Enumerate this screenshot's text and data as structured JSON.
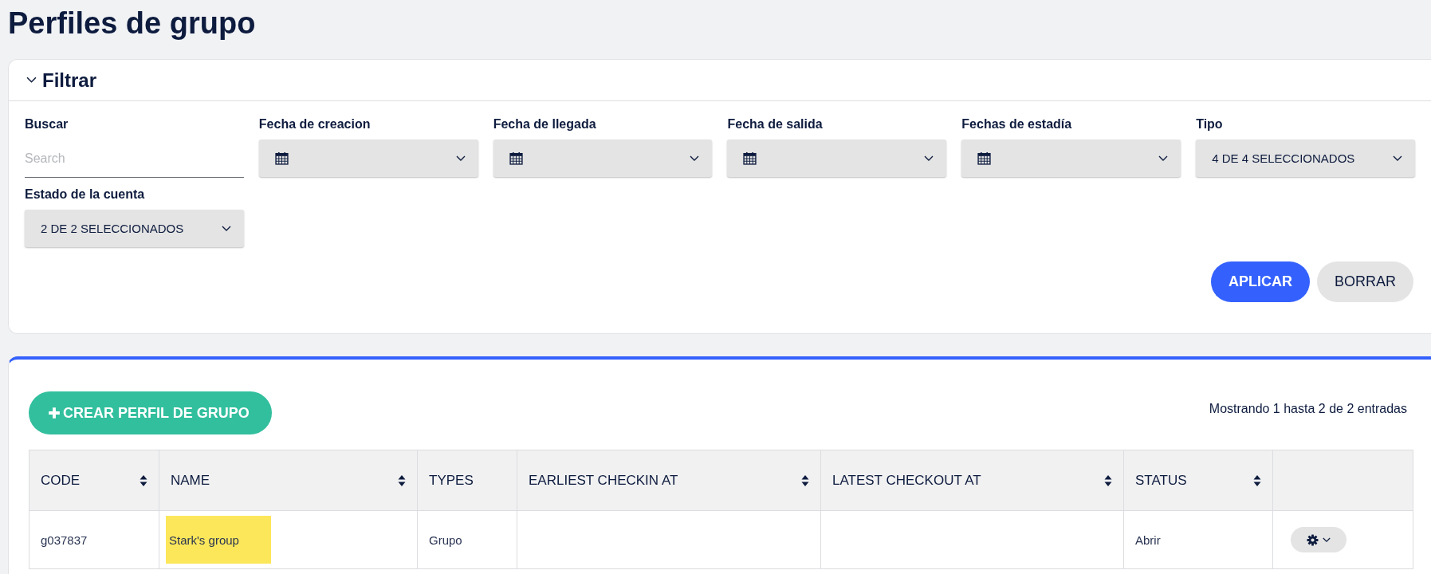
{
  "page": {
    "title": "Perfiles de grupo"
  },
  "filter": {
    "title": "Filtrar",
    "expanded": true,
    "fields": [
      {
        "kind": "text",
        "label": "Buscar",
        "placeholder": "Search"
      },
      {
        "kind": "date",
        "label": "Fecha de creacion"
      },
      {
        "kind": "date",
        "label": "Fecha de llegada"
      },
      {
        "kind": "date",
        "label": "Fecha de salida"
      },
      {
        "kind": "date",
        "label": "Fechas de estadía"
      },
      {
        "kind": "select",
        "label": "Tipo",
        "value": "4 DE 4 SELECCIONADOS"
      },
      {
        "kind": "select",
        "label": "Estado de la cuenta",
        "value": "2 DE 2 SELECCIONADOS"
      }
    ],
    "buttons": [
      {
        "label": "APLICAR",
        "kind": "primary"
      },
      {
        "label": "BORRAR",
        "kind": "secondary"
      }
    ]
  },
  "table_panel": {
    "create_button": "CREAR PERFIL DE GRUPO",
    "info": "Mostrando 1 hasta 2 de 2 entradas",
    "columns": [
      {
        "label": "CODE",
        "sortable": true
      },
      {
        "label": "NAME",
        "sortable": true
      },
      {
        "label": "TYPES",
        "sortable": false
      },
      {
        "label": "EARLIEST CHECKIN AT",
        "sortable": true
      },
      {
        "label": "LATEST CHECKOUT AT",
        "sortable": true
      },
      {
        "label": "STATUS",
        "sortable": true
      }
    ],
    "rows": [
      {
        "code": "g037837",
        "name": "Stark's group",
        "name_highlighted": true,
        "types": "Grupo",
        "status": "Abrir"
      }
    ]
  }
}
